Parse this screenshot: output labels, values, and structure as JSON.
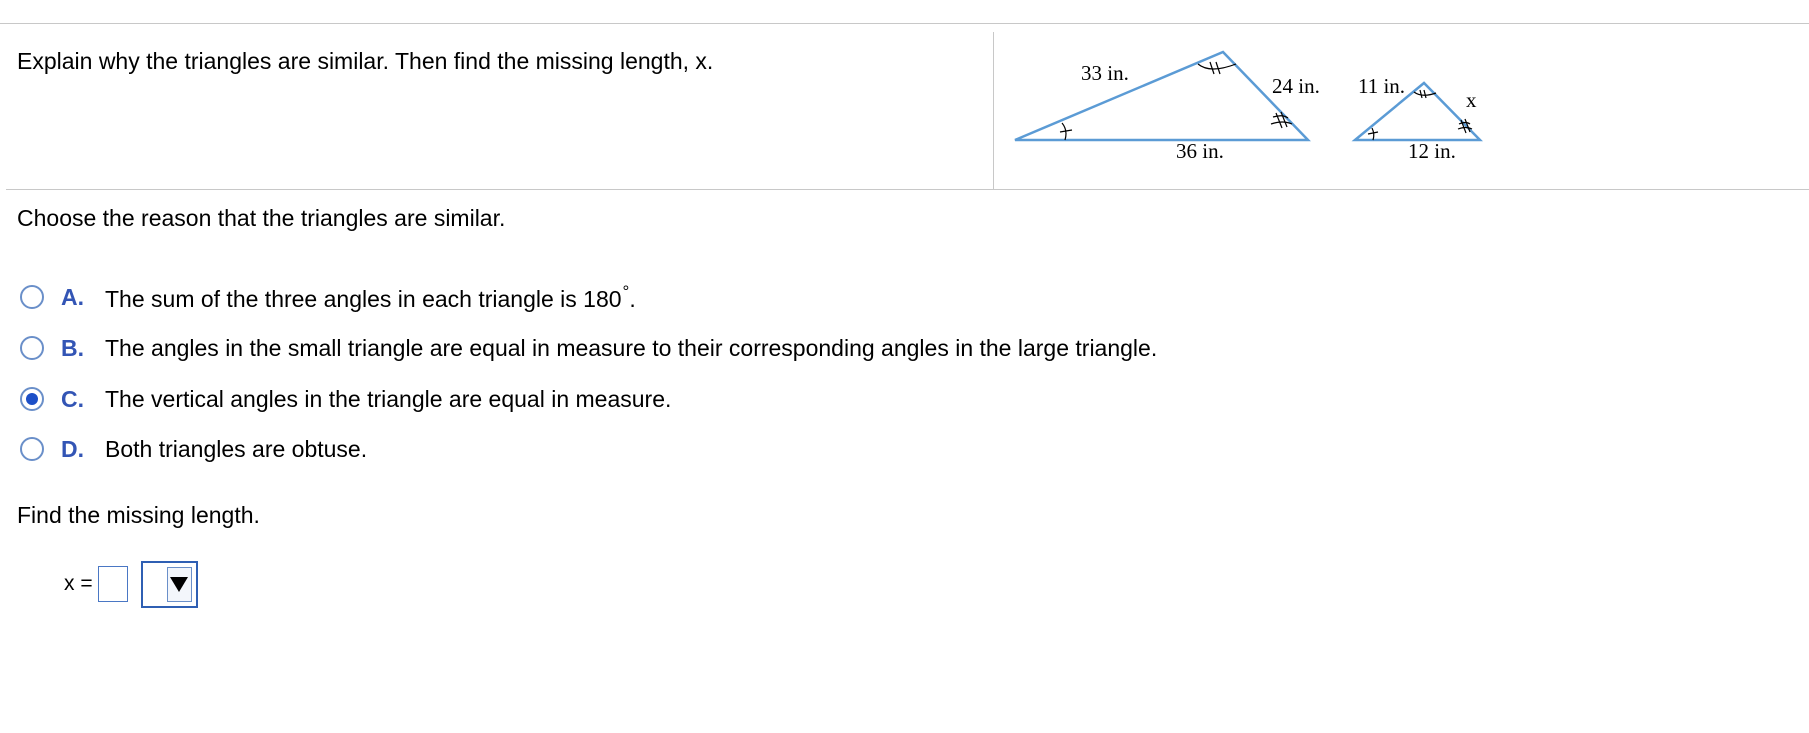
{
  "question": {
    "text": "Explain why the triangles are similar. Then find the missing length, x."
  },
  "figure": {
    "large_triangle": {
      "side_top_left": "33 in.",
      "side_right": "24 in.",
      "side_bottom": "36 in."
    },
    "small_triangle": {
      "side_top_left": "11 in.",
      "side_right": "x",
      "side_bottom": "12 in."
    },
    "stroke_color": "#5b9bd5"
  },
  "part1": {
    "prompt": "Choose the reason that the triangles are similar.",
    "selected": "C",
    "options": [
      {
        "letter": "A.",
        "text": "The sum of the three angles in each triangle is 180",
        "suffix": "°",
        "after": "."
      },
      {
        "letter": "B.",
        "text": "The angles in the small triangle are equal in measure to their corresponding angles in the large triangle."
      },
      {
        "letter": "C.",
        "text": "The vertical angles in the triangle are equal in measure."
      },
      {
        "letter": "D.",
        "text": "Both triangles are obtuse."
      }
    ]
  },
  "part2": {
    "prompt": "Find the missing length.",
    "label": "x =",
    "input_value": "",
    "unit_selected": ""
  },
  "colors": {
    "accent": "#3355b5",
    "radio_border": "#6a8fc9",
    "radio_fill": "#1c4fc7",
    "divider": "#c8c8c8"
  }
}
